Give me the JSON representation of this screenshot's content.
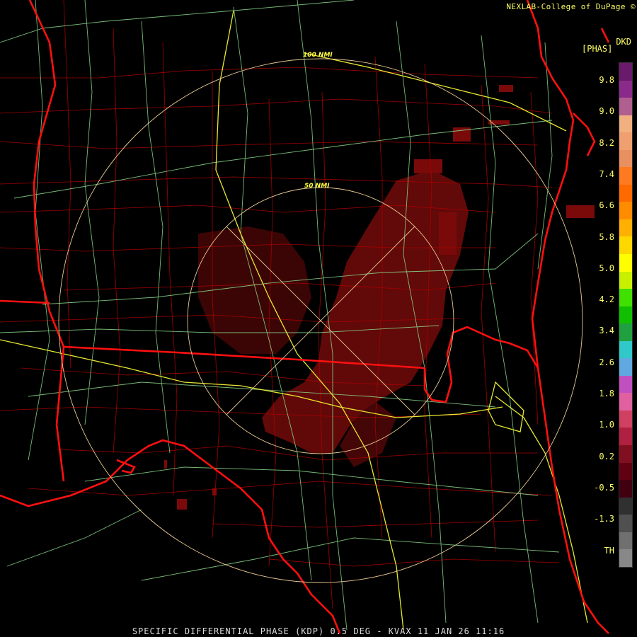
{
  "header": {
    "credit": "NEXLAB-College of DuPage ©",
    "product_code": "DKD",
    "units": "[PHAS]"
  },
  "range_rings": {
    "inner_label": "50 NMI",
    "outer_label": "100 NMI"
  },
  "colorbar": {
    "ticks": [
      "9.8",
      "9.0",
      "8.2",
      "7.4",
      "6.6",
      "5.8",
      "5.0",
      "4.2",
      "3.4",
      "2.6",
      "1.8",
      "1.0",
      "0.2",
      "-0.5",
      "-1.3",
      "TH"
    ],
    "colors": [
      "#6a1a6a",
      "#8a2a8a",
      "#b06090",
      "#f0b080",
      "#f0a070",
      "#e89060",
      "#ff7a20",
      "#ff6a00",
      "#ff8c00",
      "#ffb000",
      "#ffd800",
      "#ffff00",
      "#c8f000",
      "#40e000",
      "#10c000",
      "#20a040",
      "#30c8c8",
      "#60a8e0",
      "#c050c0",
      "#e060a0",
      "#d04060",
      "#b02040",
      "#801020",
      "#600010",
      "#400010",
      "#303030",
      "#505050",
      "#707070",
      "#888888"
    ]
  },
  "footer": {
    "caption": "SPECIFIC DIFFERENTIAL PHASE (KDP) 0.5 DEG - KVAX 11 JAN 26 11:16"
  }
}
